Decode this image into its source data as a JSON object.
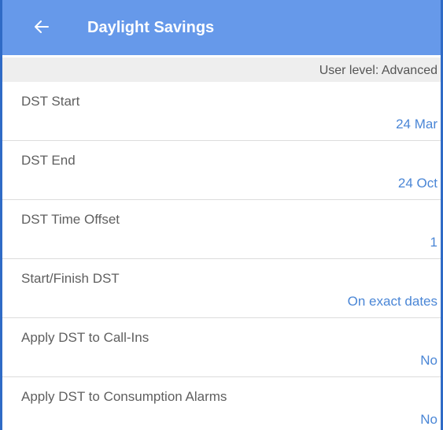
{
  "appbar": {
    "back_icon": "arrow-left-icon",
    "title": "Daylight Savings",
    "background_color": "#6699ea",
    "title_color": "#ffffff"
  },
  "user_level": {
    "text": "User level: Advanced"
  },
  "colors": {
    "frame_border": "#2f6bc6",
    "value_text": "#4a86d6",
    "label_text": "#5f5f5f",
    "subheader_bg": "#eeeeee"
  },
  "settings": [
    {
      "label": "DST Start",
      "value": "24 Mar"
    },
    {
      "label": "DST End",
      "value": "24 Oct"
    },
    {
      "label": "DST Time Offset",
      "value": "1"
    },
    {
      "label": "Start/Finish DST",
      "value": "On exact dates"
    },
    {
      "label": "Apply DST to Call-Ins",
      "value": "No"
    },
    {
      "label": "Apply DST to Consumption Alarms",
      "value": "No"
    }
  ]
}
